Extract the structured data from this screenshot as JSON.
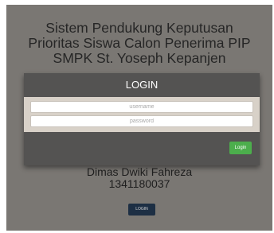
{
  "app": {
    "title_lines": [
      "Sistem Pendukung Keputusan",
      "Prioritas Siswa Calon Penerima PIP",
      "SMPK St. Yoseph Kepanjen"
    ]
  },
  "login_panel": {
    "header": "LOGIN",
    "username_placeholder": "username",
    "password_placeholder": "password",
    "submit_label": "Login"
  },
  "author": {
    "name": "Dimas Dwiki Fahreza",
    "id": "1341180037"
  },
  "bottom_button": {
    "label": "LOGIN"
  },
  "colors": {
    "background": "#7a7773",
    "panel_header": "#545352",
    "panel_body": "#d8d1c8",
    "submit_button": "#4cae4c",
    "bottom_button": "#1d2f44"
  }
}
